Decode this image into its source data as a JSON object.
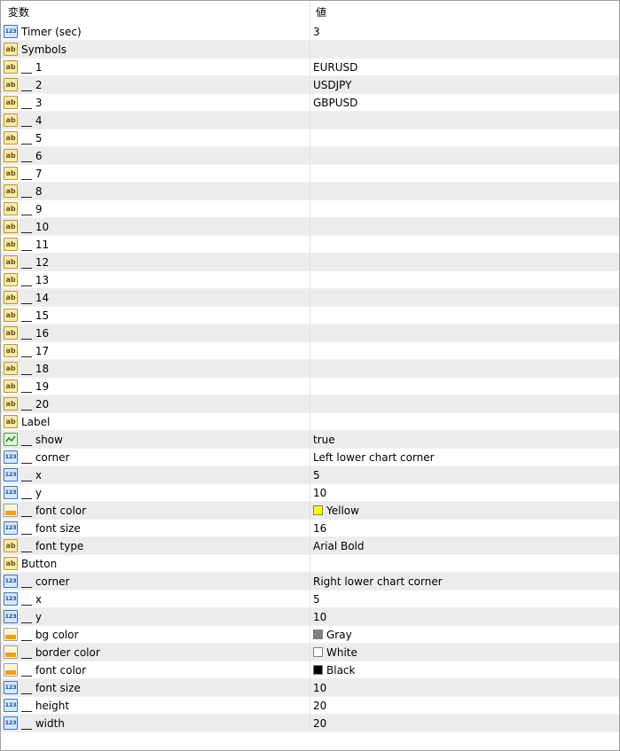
{
  "header": {
    "col_name": "変数",
    "col_value": "値"
  },
  "rows": [
    {
      "name": "Timer (sec)",
      "value": "3",
      "type": "num",
      "icon": "number-icon"
    },
    {
      "name": "Symbols",
      "value": "",
      "type": "str",
      "icon": "string-icon"
    },
    {
      "name": "__ 1",
      "value": "EURUSD",
      "type": "str",
      "icon": "string-icon"
    },
    {
      "name": "__ 2",
      "value": "USDJPY",
      "type": "str",
      "icon": "string-icon"
    },
    {
      "name": "__ 3",
      "value": "GBPUSD",
      "type": "str",
      "icon": "string-icon"
    },
    {
      "name": "__ 4",
      "value": "",
      "type": "str",
      "icon": "string-icon"
    },
    {
      "name": "__ 5",
      "value": "",
      "type": "str",
      "icon": "string-icon"
    },
    {
      "name": "__ 6",
      "value": "",
      "type": "str",
      "icon": "string-icon"
    },
    {
      "name": "__ 7",
      "value": "",
      "type": "str",
      "icon": "string-icon"
    },
    {
      "name": "__ 8",
      "value": "",
      "type": "str",
      "icon": "string-icon"
    },
    {
      "name": "__ 9",
      "value": "",
      "type": "str",
      "icon": "string-icon"
    },
    {
      "name": "__ 10",
      "value": "",
      "type": "str",
      "icon": "string-icon"
    },
    {
      "name": "__ 11",
      "value": "",
      "type": "str",
      "icon": "string-icon"
    },
    {
      "name": "__ 12",
      "value": "",
      "type": "str",
      "icon": "string-icon"
    },
    {
      "name": "__ 13",
      "value": "",
      "type": "str",
      "icon": "string-icon"
    },
    {
      "name": "__ 14",
      "value": "",
      "type": "str",
      "icon": "string-icon"
    },
    {
      "name": "__ 15",
      "value": "",
      "type": "str",
      "icon": "string-icon"
    },
    {
      "name": "__ 16",
      "value": "",
      "type": "str",
      "icon": "string-icon"
    },
    {
      "name": "__ 17",
      "value": "",
      "type": "str",
      "icon": "string-icon"
    },
    {
      "name": "__ 18",
      "value": "",
      "type": "str",
      "icon": "string-icon"
    },
    {
      "name": "__ 19",
      "value": "",
      "type": "str",
      "icon": "string-icon"
    },
    {
      "name": "__ 20",
      "value": "",
      "type": "str",
      "icon": "string-icon"
    },
    {
      "name": "Label",
      "value": "",
      "type": "str",
      "icon": "string-icon"
    },
    {
      "name": "__ show",
      "value": "true",
      "type": "bool",
      "icon": "boolean-icon"
    },
    {
      "name": "__ corner",
      "value": "Left lower chart corner",
      "type": "num",
      "icon": "number-icon"
    },
    {
      "name": "__ x",
      "value": "5",
      "type": "num",
      "icon": "number-icon"
    },
    {
      "name": "__ y",
      "value": "10",
      "type": "num",
      "icon": "number-icon"
    },
    {
      "name": "__ font color",
      "value": "Yellow",
      "type": "color",
      "icon": "color-icon",
      "swatch": "#ffff00"
    },
    {
      "name": "__ font size",
      "value": "16",
      "type": "num",
      "icon": "number-icon"
    },
    {
      "name": "__ font type",
      "value": "Arial Bold",
      "type": "str",
      "icon": "string-icon"
    },
    {
      "name": "Button",
      "value": "",
      "type": "str",
      "icon": "string-icon"
    },
    {
      "name": "__ corner",
      "value": "Right lower chart corner",
      "type": "num",
      "icon": "number-icon"
    },
    {
      "name": "__ x",
      "value": "5",
      "type": "num",
      "icon": "number-icon"
    },
    {
      "name": "__ y",
      "value": "10",
      "type": "num",
      "icon": "number-icon"
    },
    {
      "name": "__ bg color",
      "value": "Gray",
      "type": "color",
      "icon": "color-icon",
      "swatch": "#808080"
    },
    {
      "name": "__ border color",
      "value": "White",
      "type": "color",
      "icon": "color-icon",
      "swatch": "#ffffff"
    },
    {
      "name": "__ font color",
      "value": "Black",
      "type": "color",
      "icon": "color-icon",
      "swatch": "#000000"
    },
    {
      "name": "__ font size",
      "value": "10",
      "type": "num",
      "icon": "number-icon"
    },
    {
      "name": "__ height",
      "value": "20",
      "type": "num",
      "icon": "number-icon"
    },
    {
      "name": "__ width",
      "value": "20",
      "type": "num",
      "icon": "number-icon"
    }
  ],
  "icon_labels": {
    "num": "123",
    "str": "ab"
  }
}
